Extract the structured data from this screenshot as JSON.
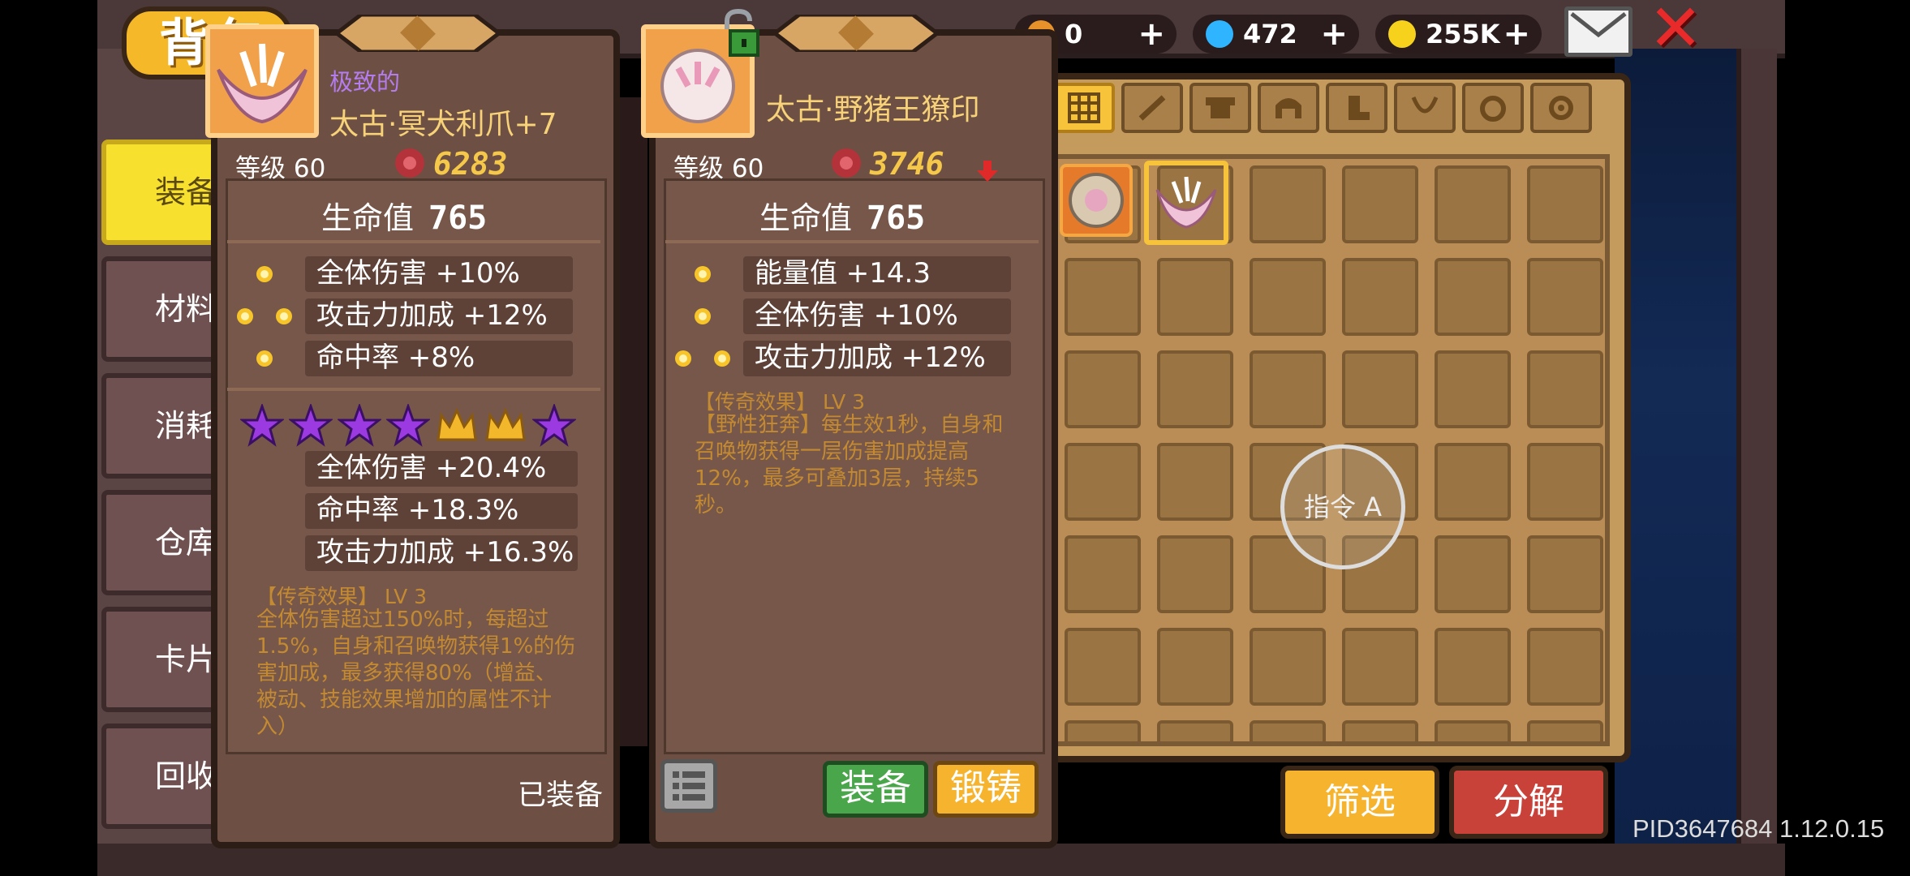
{
  "header": {
    "bag_title": "背包",
    "currencies": [
      {
        "name": "energy",
        "value": "0",
        "plus": "+",
        "color": "#e6912a"
      },
      {
        "name": "gems",
        "value": "472",
        "plus": "+",
        "color": "#2fb5ff"
      },
      {
        "name": "gold",
        "value": "255K",
        "plus": "+",
        "color": "#f7d21d"
      }
    ],
    "close_symbol": "✕"
  },
  "categories": [
    {
      "label": "装备",
      "active": true
    },
    {
      "label": "材料",
      "active": false
    },
    {
      "label": "消耗品",
      "active": false
    },
    {
      "label": "仓库",
      "active": false
    },
    {
      "label": "卡片",
      "active": false
    },
    {
      "label": "回收",
      "active": false
    }
  ],
  "card_left": {
    "grade": "极致的",
    "name": "太古·冥犬利爪+7",
    "level": "等级 60",
    "power": "6283",
    "hp_label": "生命值",
    "hp_value": "765",
    "stats": [
      {
        "gems": 1,
        "text": "全体伤害 +10%"
      },
      {
        "gems": 2,
        "text": "攻击力加成 +12%"
      },
      {
        "gems": 1,
        "text": "命中率 +8%"
      }
    ],
    "stars": [
      "purple",
      "purple",
      "purple",
      "purple",
      "crown",
      "crown",
      "purple"
    ],
    "bonus_stats": [
      "全体伤害 +20.4%",
      "命中率 +18.3%",
      "攻击力加成 +16.3%"
    ],
    "legend_title": "【传奇效果】 LV 3",
    "legend_text": "全体伤害超过150%时，每超过1.5%，自身和召唤物获得1%的伤害加成，最多获得80%（增益、被动、技能效果增加的属性不计入）",
    "equipped_label": "已装备"
  },
  "card_right": {
    "name": "太古·野猪王獠印",
    "level": "等级 60",
    "power": "3746",
    "hp_label": "生命值",
    "hp_value": "765",
    "stats": [
      {
        "gems": 1,
        "text": "能量值 +14.3"
      },
      {
        "gems": 1,
        "text": "全体伤害 +10%"
      },
      {
        "gems": 2,
        "text": "攻击力加成 +12%"
      }
    ],
    "legend_title": "【传奇效果】 LV 3",
    "legend_text": "【野性狂奔】每生效1秒，自身和召唤物获得一层伤害加成提高12%，最多可叠加3层，持续5秒。",
    "equip_label": "装备",
    "forge_label": "锻铸"
  },
  "inventory": {
    "tabs": [
      "all",
      "weapon",
      "armor",
      "helmet",
      "boots",
      "necklace",
      "ring",
      "gear"
    ],
    "filter_label": "筛选",
    "decompose_label": "分解"
  },
  "command_label": "指令 A",
  "version": "PID3647684 1.12.0.15",
  "colors": {
    "panel": "#6d5043",
    "accent_gold": "#f6b42e",
    "legend": "#c48a32",
    "grade_purple": "#b57cf0"
  }
}
